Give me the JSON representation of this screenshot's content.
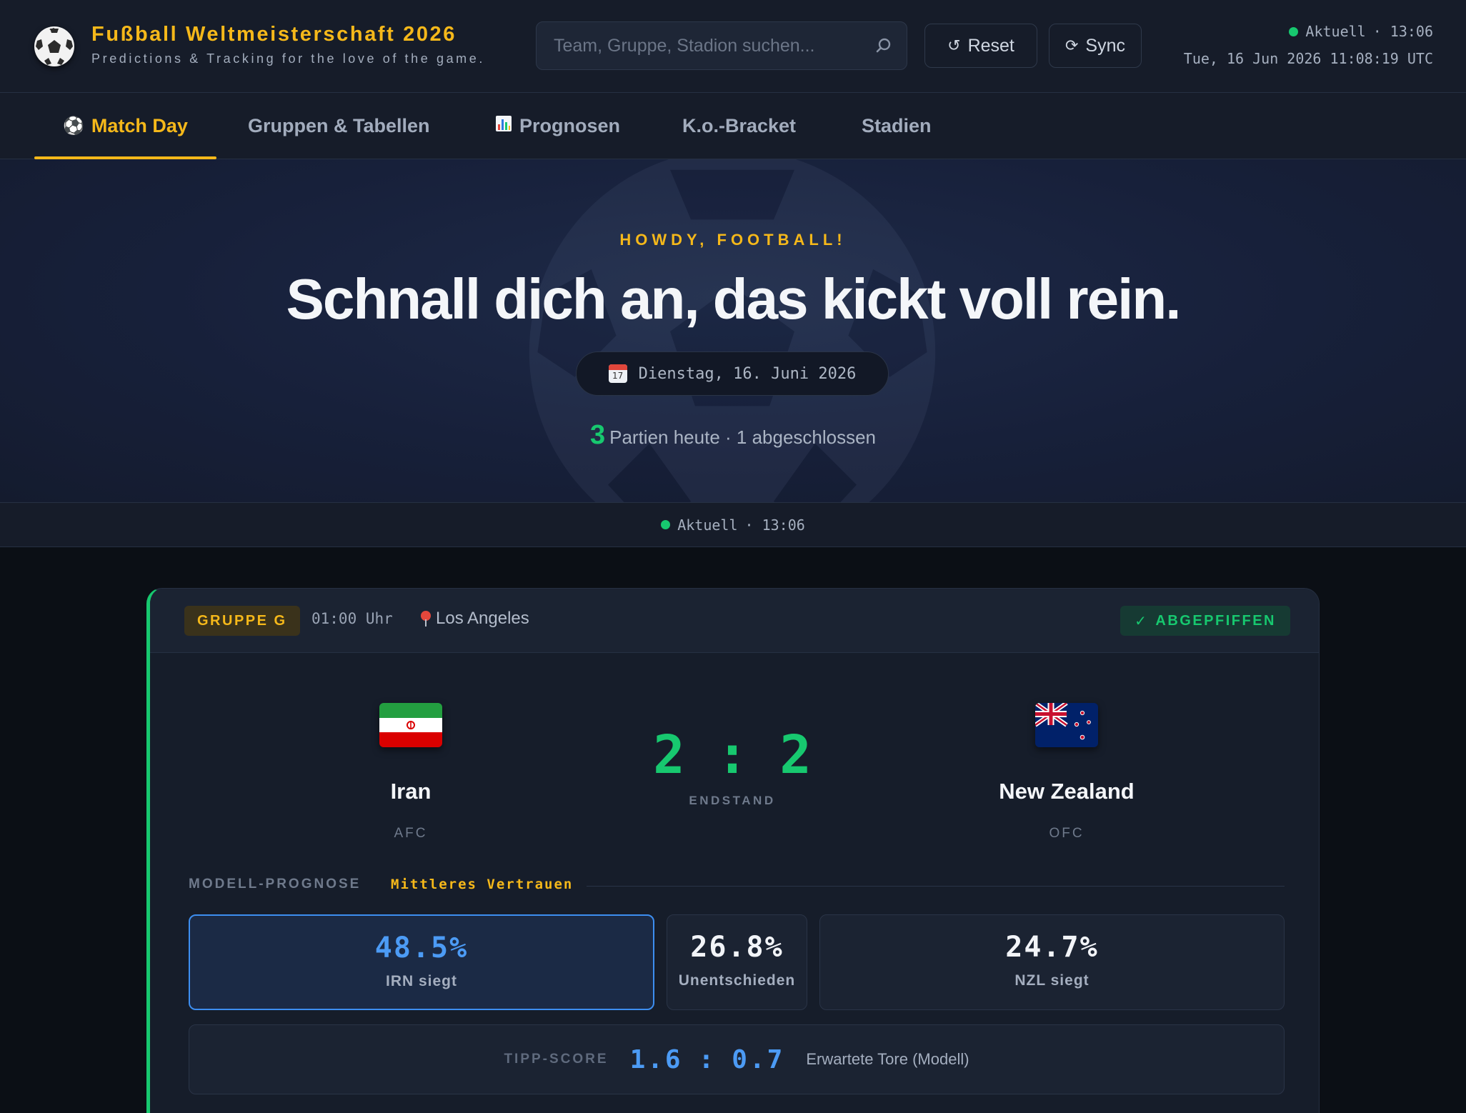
{
  "header": {
    "title": "Fußball Weltmeisterschaft 2026",
    "subtitle": "Predictions & Tracking for the love of the game.",
    "search_placeholder": "Team, Gruppe, Stadion suchen...",
    "reset_label": "Reset",
    "sync_label": "Sync",
    "status_label": "Aktuell",
    "status_time": "· 13:06",
    "datetime": "Tue, 16 Jun 2026 11:08:19 UTC",
    "status_color": "#17c86f"
  },
  "nav": {
    "tabs": [
      {
        "label": "Match Day",
        "icon": "soccer-ball-icon",
        "active": true
      },
      {
        "label": "Gruppen & Tabellen"
      },
      {
        "label": "Prognosen",
        "icon": "bar-chart-icon"
      },
      {
        "label": "K.o.-Bracket"
      },
      {
        "label": "Stadien"
      }
    ],
    "accent": "#f5b81a"
  },
  "hero": {
    "kicker": "HOWDY, FOOTBALL!",
    "title": "Schnall dich an, das kickt voll rein.",
    "date": "Dienstag, 16. Juni 2026",
    "calendar_day": "17",
    "count": "3",
    "summary": "Partien heute · 1 abgeschlossen"
  },
  "band": {
    "status_label": "Aktuell",
    "status_time": "· 13:06"
  },
  "match": {
    "group": "GRUPPE G",
    "time": "01:00 Uhr",
    "venue": "Los Angeles",
    "status": "ABGEPFIFFEN",
    "home": {
      "name": "Iran",
      "conf": "AFC",
      "flag": "iran-flag-icon"
    },
    "away": {
      "name": "New Zealand",
      "conf": "OFC",
      "flag": "new-zealand-flag-icon"
    },
    "score_home": "2",
    "score_sep": ":",
    "score_away": "2",
    "score_label": "ENDSTAND",
    "model_label": "MODELL-PROGNOSE",
    "model_confidence": "Mittleres Vertrauen",
    "probs": [
      {
        "value": "48.5%",
        "label": "IRN siegt"
      },
      {
        "value": "26.8%",
        "label": "Unentschieden"
      },
      {
        "value": "24.7%",
        "label": "NZL siegt"
      }
    ],
    "tipp_label": "TIPP-SCORE",
    "tipp_home": "1.6",
    "tipp_sep": ":",
    "tipp_away": "0.7",
    "tipp_note": "Erwartete Tore (Modell)",
    "win_color": "#17c86f",
    "highlight_color": "#4c9bf5"
  }
}
